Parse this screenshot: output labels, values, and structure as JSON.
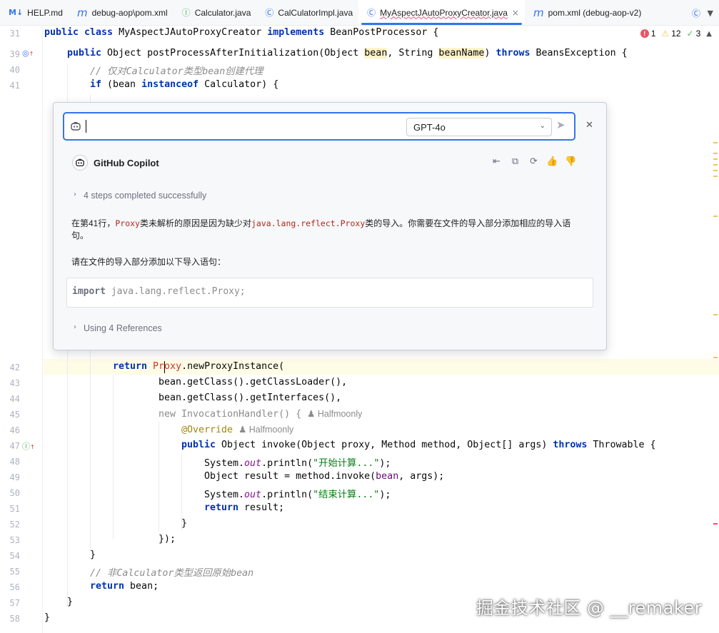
{
  "tabs": [
    {
      "icon": "M↓",
      "label": "HELP.md"
    },
    {
      "icon": "m",
      "label": "debug-aop\\pom.xml"
    },
    {
      "icon": "Ⓘ",
      "label": "Calculator.java"
    },
    {
      "icon": "Ⓒ",
      "label": "CalCulatorImpl.java"
    },
    {
      "icon": "Ⓒ",
      "label": "MyAspectJAutoProxyCreator.java",
      "close": "×"
    },
    {
      "icon": "m",
      "label": "pom.xml (debug-aop-v2)"
    }
  ],
  "inspections": {
    "errors": "1",
    "warnings": "12",
    "checks": "3"
  },
  "editor": {
    "line_numbers": {
      "l31": "31",
      "l39": "39",
      "l40": "40",
      "l41": "41",
      "l42": "42",
      "l43": "43",
      "l44": "44",
      "l45": "45",
      "l46": "46",
      "l47": "47",
      "l48": "48",
      "l49": "49",
      "l50": "50",
      "l51": "51",
      "l52": "52",
      "l53": "53",
      "l54": "54",
      "l55": "55",
      "l56": "56",
      "l57": "57",
      "l58": "58"
    },
    "lines": {
      "l31_a": "public class ",
      "l31_b": "MyAspectJAutoProxyCreator ",
      "l31_c": "implements ",
      "l31_d": "BeanPostProcessor {",
      "l39_a": "public ",
      "l39_b": "Object postProcessAfterInitialization(Object ",
      "l39_c": "bean",
      "l39_d": ", String ",
      "l39_e": "beanName",
      "l39_f": ") ",
      "l39_g": "throws ",
      "l39_h": "BeansException {",
      "l40": "// 仅对Calculator类型bean创建代理",
      "l41_a": "if ",
      "l41_b": "(bean ",
      "l41_c": "instanceof ",
      "l41_d": "Calculator) {",
      "l42_a": "return ",
      "l42_b": "Proxy",
      "l42_c": ".newProxyInstance(",
      "l43": "bean.getClass().getClassLoader(),",
      "l44": "bean.getClass().getInterfaces(),",
      "l45_a": "new ",
      "l45_b": "InvocationHandler() {",
      "l45_hint": "Halfmoonly",
      "l46_a": "@Override",
      "l46_hint": "Halfmoonly",
      "l47_a": "public ",
      "l47_b": "Object invoke(Object proxy, Method method, Object[] args) ",
      "l47_c": "throws ",
      "l47_d": "Throwable {",
      "l48_a": "System.",
      "l48_b": "out",
      "l48_c": ".println(",
      "l48_d": "\"开始计算...\"",
      "l48_e": ");",
      "l49_a": "Object result = method.invoke(",
      "l49_b": "bean",
      "l49_c": ", args);",
      "l50_a": "System.",
      "l50_b": "out",
      "l50_c": ".println(",
      "l50_d": "\"结束计算...\"",
      "l50_e": ");",
      "l51_a": "return ",
      "l51_b": "result;",
      "l52": "}",
      "l53": "});",
      "l54": "}",
      "l55": "// 非Calculator类型返回原始bean",
      "l56_a": "return ",
      "l56_b": "bean;",
      "l57": "}",
      "l58": "}"
    }
  },
  "copilot": {
    "prompt_value": "",
    "model": "GPT-4o",
    "assistant_name": "GitHub Copilot",
    "steps": "4 steps completed successfully",
    "answer_a": "在第41行，",
    "answer_b": "Proxy",
    "answer_c": "类未解析的原因是因为缺少对",
    "answer_d": "java.lang.reflect.Proxy",
    "answer_e": "类的导入。你需要在文件的导入部分添加相应的导入语句。",
    "answer2": "请在文件的导入部分添加以下导入语句：",
    "code_kw": "import",
    "code_rest": " java.lang.reflect.Proxy;",
    "references": "Using 4 References"
  },
  "watermark": "掘金技术社区 @ __remaker"
}
